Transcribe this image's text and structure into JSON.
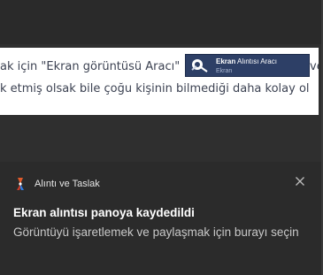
{
  "background_page": {
    "line1": "ak için \"Ekran görüntüsü Aracı\"",
    "line1_tail": "ve",
    "line2": "k etmiş olsak bile çoğu kişinin bilmediği daha kolay ol",
    "inline_screenshot": {
      "title_bold": "Ekran",
      "title_rest": " Alıntısı Aracı",
      "sub": "Ekran"
    }
  },
  "notification": {
    "app_name": "Alıntı ve Taslak",
    "title": "Ekran alıntısı panoya kaydedildi",
    "body": "Görüntüyü işaretlemek ve paylaşmak için burayı seçin",
    "icons": {
      "app": "snip-and-sketch-icon",
      "close": "close-icon"
    }
  },
  "colors": {
    "toast_bg": "#2b2b2b",
    "title": "#ffffff",
    "body": "#c8c8c8"
  }
}
